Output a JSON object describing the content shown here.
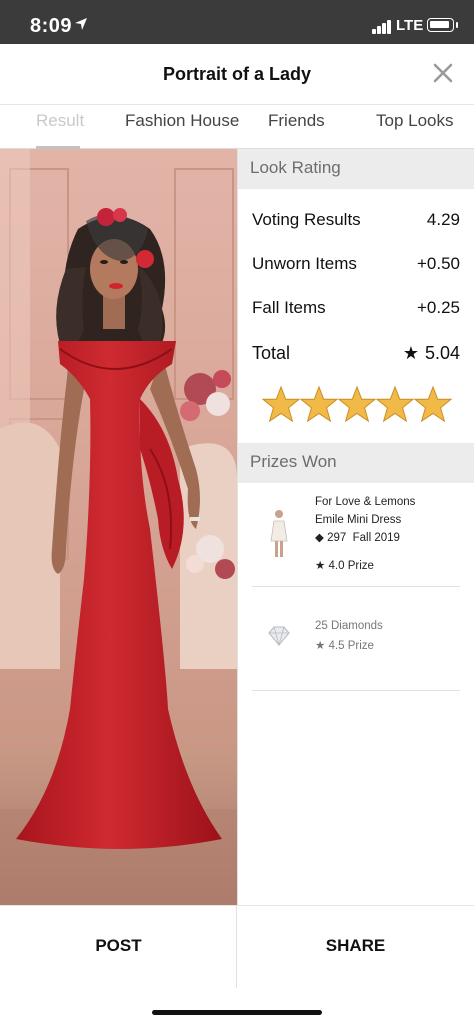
{
  "status_bar": {
    "time": "8:09",
    "network": "LTE"
  },
  "header": {
    "title": "Portrait of a Lady",
    "close_icon": "close-icon"
  },
  "tabs": [
    {
      "label": "Result",
      "active": true
    },
    {
      "label": "Fashion House",
      "active": false
    },
    {
      "label": "Friends",
      "active": false
    },
    {
      "label": "Top Looks",
      "active": false
    }
  ],
  "look_rating": {
    "header": "Look Rating",
    "rows": [
      {
        "label": "Voting Results",
        "value": "4.29"
      },
      {
        "label": "Unworn Items",
        "value": "+0.50"
      },
      {
        "label": "Fall Items",
        "value": "+0.25"
      }
    ],
    "total_label": "Total",
    "total_value": "5.04",
    "stars": 5
  },
  "prizes": {
    "header": "Prizes Won",
    "items": [
      {
        "name_line1": "For Love & Lemons",
        "name_line2": "Emile Mini Dress",
        "price": "297",
        "season": "Fall 2019",
        "prize": "4.0 Prize",
        "icon": "dress-icon"
      },
      {
        "name_line1": "25 Diamonds",
        "prize": "4.5 Prize",
        "icon": "diamond-icon"
      }
    ]
  },
  "actions": {
    "post_label": "POST",
    "share_label": "SHARE"
  },
  "colors": {
    "dress": "#c4242c",
    "star_gold": "#f1b948",
    "section_bg": "#ececec"
  }
}
